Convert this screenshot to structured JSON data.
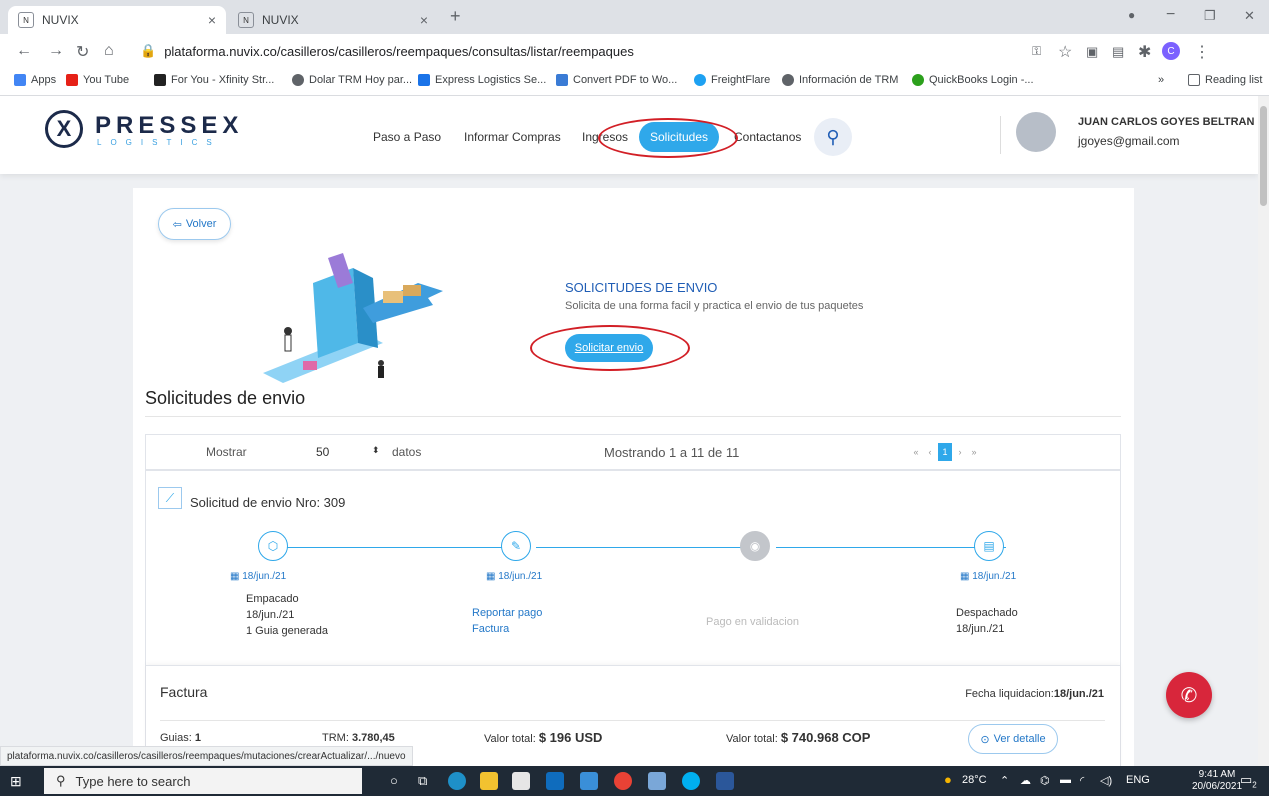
{
  "browser": {
    "tabs": [
      {
        "favicon": "N",
        "title": "NUVIX",
        "close": "×"
      },
      {
        "favicon": "N",
        "title": "NUVIX",
        "close": "×"
      }
    ],
    "new_tab": "+",
    "window_controls": {
      "minimize": "−",
      "maximize": "❐",
      "close": "✕"
    },
    "url": "plataforma.nuvix.co/casilleros/casilleros/reempaques/consultas/listar/reempaques",
    "bookmarks": [
      {
        "label": "Apps",
        "color": "#4285f4"
      },
      {
        "label": "You Tube",
        "color": "#e62117"
      },
      {
        "label": "For You - Xfinity Str...",
        "color": "#222222"
      },
      {
        "label": "Dolar TRM Hoy par...",
        "color": "#5f6368"
      },
      {
        "label": "Express Logistics Se...",
        "color": "#1a73e8"
      },
      {
        "label": "Convert PDF to Wo...",
        "color": "#3a7bd5"
      },
      {
        "label": "FreightFlare",
        "color": "#1da1f2"
      },
      {
        "label": "Información de TRM",
        "color": "#5f6368"
      },
      {
        "label": "QuickBooks Login -...",
        "color": "#2ca01c"
      }
    ],
    "reading_list": "Reading list",
    "more_bookmarks": "»",
    "profile_letter": "C",
    "status_url": "plataforma.nuvix.co/casilleros/casilleros/reempaques/mutaciones/crearActualizar/.../nuevo"
  },
  "header": {
    "logo_mark": "X",
    "logo_word": "PRESSEX",
    "logo_sub": "LOGISTICS",
    "nav": [
      "Paso a Paso",
      "Informar Compras",
      "Ingresos",
      "Solicitudes",
      "Contactanos"
    ],
    "active_nav": "Solicitudes",
    "user_name": "JUAN CARLOS GOYES BELTRAN",
    "user_email": "jgoyes@gmail.com"
  },
  "page": {
    "back_label": "Volver",
    "promo_title": "SOLICITUDES DE ENVIO",
    "promo_desc": "Solicita de una forma facil y practica el envio de tus paquetes",
    "promo_button": "Solicitar envio",
    "section_title": "Solicitudes de envio"
  },
  "table_controls": {
    "show_label": "Mostrar",
    "page_size": "50",
    "data_label": "datos",
    "info": "Mostrando 1 a 11 de 11",
    "pager": [
      "«",
      "‹",
      "1",
      "›",
      "»"
    ],
    "current_page": "1"
  },
  "request": {
    "title": "Solicitud de envio Nro: 309",
    "steps": [
      {
        "icon": "box-icon",
        "date": "18/jun./21",
        "lines": [
          "Empacado",
          "18/jun./21",
          "1 Guia generada"
        ]
      },
      {
        "icon": "edit-icon",
        "date": "18/jun./21",
        "lines": [
          "Reportar pago",
          "Factura"
        ]
      },
      {
        "icon": "cash-icon",
        "date": "",
        "lines": [
          "Pago en validacion"
        ]
      },
      {
        "icon": "archive-icon",
        "date": "18/jun./21",
        "lines": [
          "Despachado",
          "18/jun./21"
        ]
      }
    ]
  },
  "invoice": {
    "title": "Factura",
    "date_label": "Fecha liquidacion:",
    "date_value": "18/jun./21",
    "guias_label": "Guias:",
    "guias_value": "1",
    "trm_label": "TRM:",
    "trm_value": "3.780,45",
    "usd_label": "Valor total:",
    "usd_value": "$ 196 USD",
    "cop_label": "Valor total:",
    "cop_value": "$ 740.968 COP",
    "detail_button": "Ver detalle"
  },
  "taskbar": {
    "search_placeholder": "Type here to search",
    "weather": "28°C",
    "lang": "ENG",
    "time": "9:41 AM",
    "date": "20/06/2021",
    "notifications": "2"
  }
}
